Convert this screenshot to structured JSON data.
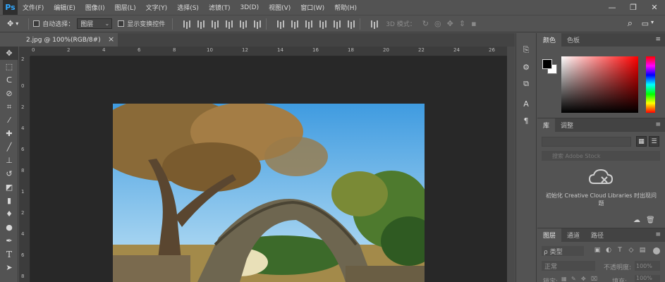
{
  "app": {
    "logo": "Ps"
  },
  "menu": [
    "文件(F)",
    "编辑(E)",
    "图像(I)",
    "图层(L)",
    "文字(Y)",
    "选择(S)",
    "滤镜(T)",
    "3D(D)",
    "视图(V)",
    "窗口(W)",
    "帮助(H)"
  ],
  "window_controls": {
    "minimize": "—",
    "maximize": "❐",
    "close": "✕"
  },
  "options": {
    "tool_icon": "move-tool-icon",
    "auto_select_label": "自动选择：",
    "auto_select_checked": false,
    "auto_select_value": "图层",
    "transform_label": "显示变换控件",
    "transform_checked": false,
    "mode3d_label": "3D 模式："
  },
  "document": {
    "tab_title": "2.jpg @ 100%(RGB/8#)",
    "close": "×"
  },
  "ruler": {
    "top_ticks": [
      "0",
      "2",
      "4",
      "6",
      "8",
      "10",
      "12",
      "14",
      "16",
      "18",
      "20",
      "22",
      "24",
      "26"
    ],
    "left_ticks": [
      "2",
      "0",
      "2",
      "4",
      "6",
      "8",
      "1",
      "2",
      "4",
      "6",
      "8"
    ]
  },
  "panels": {
    "color": {
      "tabs": [
        "颜色",
        "色板"
      ],
      "foreground": "#000000",
      "background": "#ffffff"
    },
    "library": {
      "tabs": [
        "库",
        "调整"
      ],
      "search_placeholder": "搜索 Adobe Stock",
      "message": "初始化 Creative Cloud Libraries 时出现问题"
    },
    "layers": {
      "tabs": [
        "图层",
        "通道",
        "路径"
      ],
      "filter_label": "ρ 类型",
      "blend_mode": "正常",
      "opacity_label": "不透明度:",
      "opacity_value": "100%",
      "lock_label": "锁定:",
      "fill_label": "填充:",
      "fill_value": "100%"
    }
  },
  "colors": {
    "accent": "#31a8ff",
    "ui_bg": "#535353",
    "canvas_bg": "#282828"
  }
}
